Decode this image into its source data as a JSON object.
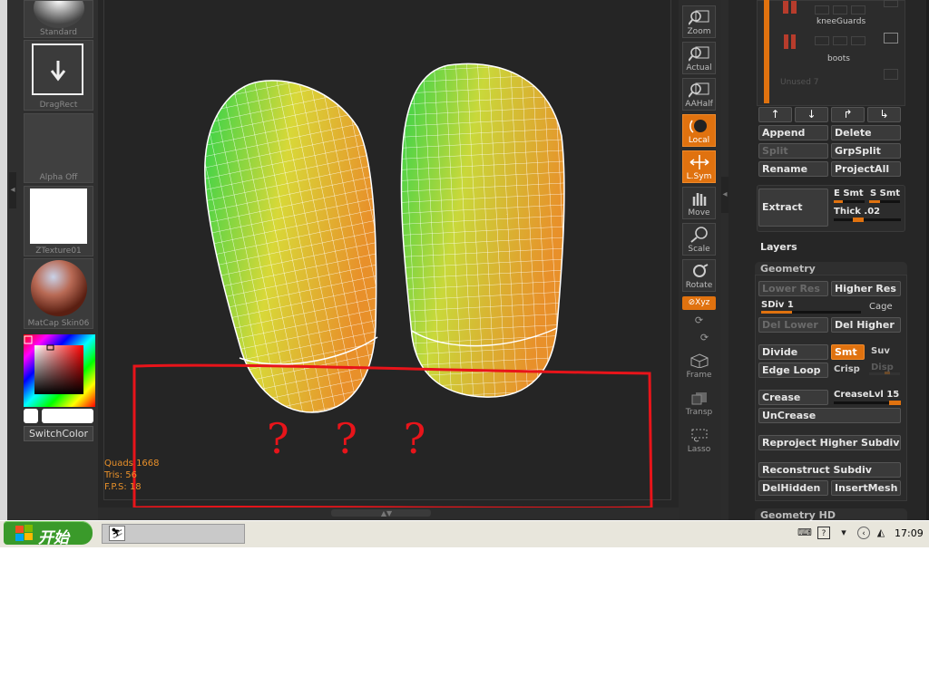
{
  "left_shelf": {
    "tiles": [
      {
        "label": "Standard"
      },
      {
        "label": "DragRect"
      },
      {
        "label": "Alpha  Off"
      },
      {
        "label": "ZTexture01"
      },
      {
        "label": "MatCap  Skin06"
      }
    ],
    "switch_color_label": "SwitchColor"
  },
  "viewport": {
    "stats": {
      "quads": "Quads 1668",
      "tris": "Tris: 56",
      "fps": "F.P.S: 18"
    },
    "annotation_text": "? ? ?",
    "annotation_color": "#e8141a",
    "mesh_colors": {
      "green": "#2fd34a",
      "yellow": "#d8d838",
      "orange": "#e8902a",
      "wire": "#ffffff"
    }
  },
  "right_shelf": {
    "buttons": [
      {
        "label": "Zoom",
        "active": false
      },
      {
        "label": "Actual",
        "active": false
      },
      {
        "label": "AAHalf",
        "active": false
      },
      {
        "label": "Local",
        "active": true
      },
      {
        "label": "L.Sym",
        "active": true
      },
      {
        "label": "Move",
        "active": false
      },
      {
        "label": "Scale",
        "active": false
      },
      {
        "label": "Rotate",
        "active": false
      }
    ],
    "xyz_label": "⊘Xyz",
    "plain": [
      {
        "label": "Frame"
      },
      {
        "label": "Transp"
      },
      {
        "label": "Lasso"
      }
    ]
  },
  "subtool": {
    "items": [
      {
        "name": "kneeGuards"
      },
      {
        "name": "boots"
      },
      {
        "name": "Unused  7"
      }
    ],
    "arrows": [
      "↑",
      "↓",
      "↱",
      "↳"
    ],
    "append": "Append",
    "delete": "Delete",
    "split": "Split",
    "grpsplit": "GrpSplit",
    "rename": "Rename",
    "projectall": "ProjectAll",
    "extract": "Extract",
    "e_smt": "E Smt",
    "s_smt": "S Smt",
    "thick": "Thick .02"
  },
  "layers_label": "Layers",
  "geometry": {
    "header": "Geometry",
    "lower_res": "Lower Res",
    "higher_res": "Higher Res",
    "sdiv": "SDiv 1",
    "cage": "Cage",
    "del_lower": "Del Lower",
    "del_higher": "Del Higher",
    "divide": "Divide",
    "smt": "Smt",
    "suv": "Suv",
    "edge_loop": "Edge Loop",
    "crisp": "Crisp",
    "disp": "Disp",
    "crease": "Crease",
    "crease_lvl": "CreaseLvl 15",
    "uncrease": "UnCrease",
    "reproject": "Reproject Higher Subdiv",
    "reconstruct": "Reconstruct Subdiv",
    "delhidden": "DelHidden",
    "insertmesh": "InsertMesh"
  },
  "geometry_hd_label": "Geometry HD",
  "taskbar": {
    "start_label": "开始",
    "clock": "17:09"
  },
  "accent_color": "#e0720f"
}
